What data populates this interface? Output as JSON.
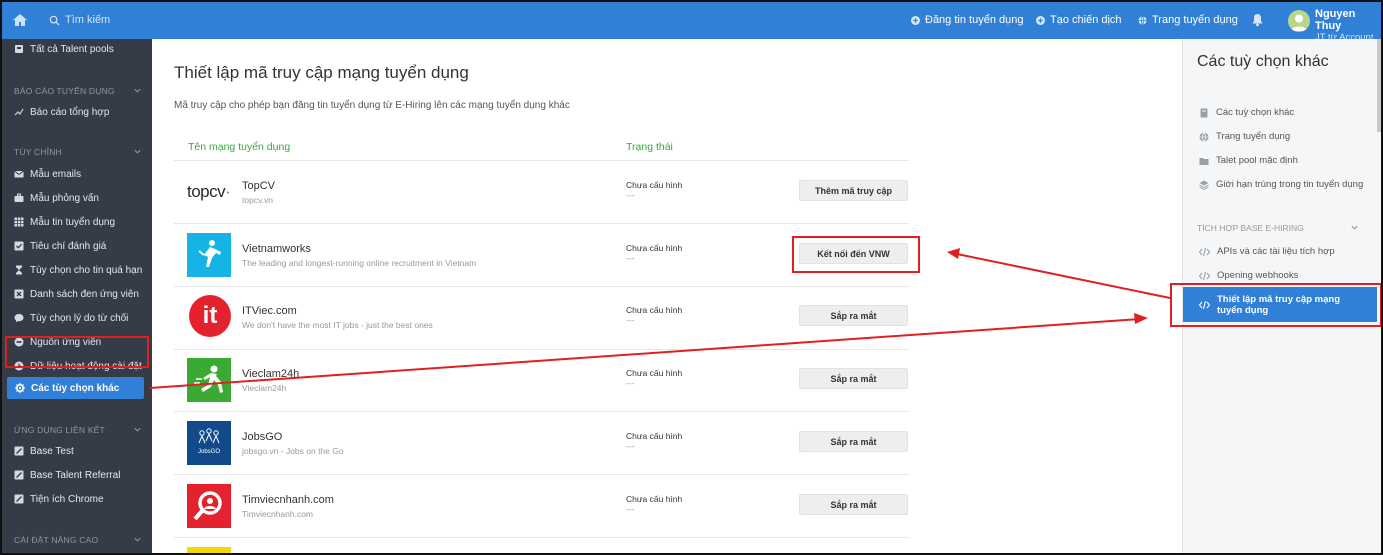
{
  "topbar": {
    "search_placeholder": "Tìm kiếm",
    "nav": [
      "Đăng tin tuyển dụng",
      "Tạo chiến dịch",
      "Trang tuyển dụng"
    ],
    "user_name": "Nguyen Thuy",
    "user_sub": "JT từ Account"
  },
  "sidebar": {
    "top_item": "Tất cả Talent pools",
    "sec_report": "BÁO CÁO TUYỂN DỤNG",
    "report_item": "Báo cáo tổng hợp",
    "sec_custom": "TÙY CHỈNH",
    "custom_items": [
      "Mẫu emails",
      "Mẫu phỏng vấn",
      "Mẫu tin tuyển dụng",
      "Tiêu chí đánh giá",
      "Tùy chọn cho tin quá hạn",
      "Danh sách đen ứng viên",
      "Tùy chọn lý do từ chối",
      "Nguồn ứng viên",
      "Dữ liệu hoạt động cài đặt"
    ],
    "active_item": "Các tùy chọn khác",
    "sec_apps": "ỨNG DỤNG LIÊN KẾT",
    "app_items": [
      "Base Test",
      "Base Talent Referral",
      "Tiện ích Chrome"
    ],
    "sec_advanced": "CÀI ĐẶT NÂNG CAO"
  },
  "main": {
    "title": "Thiết lập mã truy cập mạng tuyển dụng",
    "desc": "Mã truy cập cho phép bạn đăng tin tuyển dụng từ E-Hiring lên các mạng tuyển dụng khác",
    "col_network": "Tên mạng tuyển dụng",
    "col_status": "Trạng thái",
    "rows": [
      {
        "name": "TopCV",
        "sub": "topcv.vn",
        "status": "Chưa cấu hình",
        "dash": "---",
        "button": "Thêm mã truy cập",
        "logo_text": "topcv"
      },
      {
        "name": "Vietnamworks",
        "sub": "The leading and longest-running online recruitment in Vietnam",
        "status": "Chưa cấu hình",
        "dash": "---",
        "button": "Kết nối đến VNW"
      },
      {
        "name": "ITViec.com",
        "sub": "We don't have the most IT jobs - just the best ones",
        "status": "Chưa cấu hình",
        "dash": "---",
        "button": "Sắp ra mắt",
        "logo_text": "it"
      },
      {
        "name": "Vieclam24h",
        "sub": "Vieclam24h",
        "status": "Chưa cấu hình",
        "dash": "---",
        "button": "Sắp ra mắt"
      },
      {
        "name": "JobsGO",
        "sub": "jobsgo.vn - Jobs on the Go",
        "status": "Chưa cấu hình",
        "dash": "---",
        "button": "Sắp ra mắt",
        "logo_text": "JobsGO"
      },
      {
        "name": "Timviecnhanh.com",
        "sub": "Timviecnhanh.com",
        "status": "Chưa cấu hình",
        "dash": "---",
        "button": "Sắp ra mắt"
      }
    ]
  },
  "rpanel": {
    "title": "Các tuỳ chọn khác",
    "items": [
      "Các tuỳ chọn khác",
      "Trang tuyển dụng",
      "Talet pool mặc định",
      "Giới hạn trùng trong tin tuyển dụng"
    ],
    "sec": "TÍCH HỢP BASE E-HIRING",
    "integ_items": [
      "APIs và các tài liệu tích hợp",
      "Opening webhooks"
    ],
    "active": "Thiết lập mã truy cập mạng tuyển dụng"
  },
  "colors": {
    "primary": "#2f80d6",
    "sidebar": "#353c48",
    "green": "#38a83e",
    "annotation": "#e02020"
  }
}
